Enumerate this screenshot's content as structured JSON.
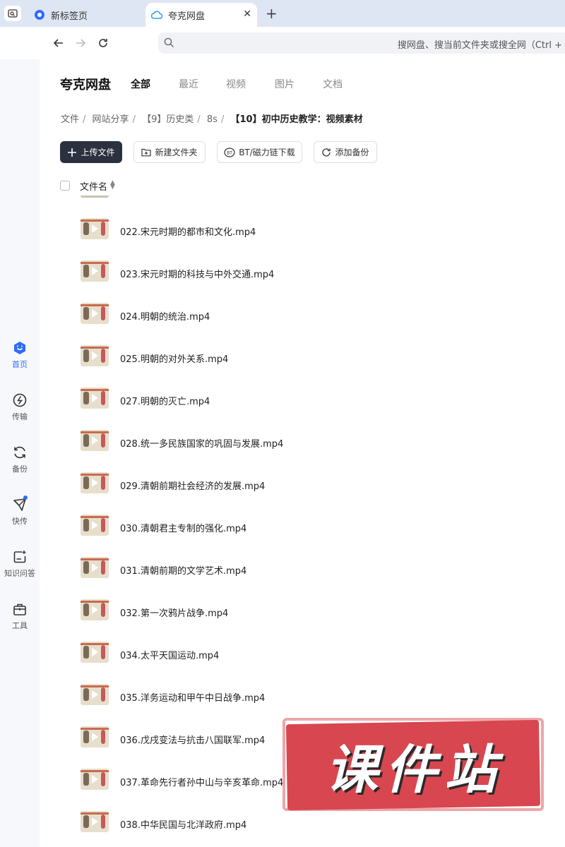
{
  "browser": {
    "tabs": [
      {
        "title": "新标签页",
        "active": false
      },
      {
        "title": "夸克网盘",
        "active": true
      }
    ],
    "address_placeholder": "搜网盘、搜当前文件夹或搜全网（Ctrl +"
  },
  "rail": {
    "items": [
      {
        "label": "首页",
        "icon": "smile-cloud-icon",
        "active": true
      },
      {
        "label": "传输",
        "icon": "transfer-icon"
      },
      {
        "label": "备份",
        "icon": "backup-icon"
      },
      {
        "label": "快传",
        "icon": "paper-plane-icon"
      },
      {
        "label": "知识问答",
        "icon": "qa-icon"
      },
      {
        "label": "工具",
        "icon": "toolbox-icon"
      }
    ]
  },
  "header": {
    "brand": "夸克网盘",
    "categories": [
      "全部",
      "最近",
      "视频",
      "图片",
      "文档"
    ]
  },
  "breadcrumb": [
    "文件",
    "网站分享",
    "【9】历史类",
    "8s",
    "【10】初中历史教学：视频素材"
  ],
  "actions": {
    "upload": "上传文件",
    "new_folder": "新建文件夹",
    "bt": "BT/磁力链下载",
    "backup": "添加备份"
  },
  "table": {
    "column": "文件名"
  },
  "files": [
    "022.宋元时期的都市和文化.mp4",
    "023.宋元时期的科技与中外交通.mp4",
    "024.明朝的统治.mp4",
    "025.明朝的对外关系.mp4",
    "027.明朝的灭亡.mp4",
    "028.统一多民族国家的巩固与发展.mp4",
    "029.清朝前期社会经济的发展.mp4",
    "030.清朝君主专制的强化.mp4",
    "031.清朝前期的文学艺术.mp4",
    "032.第一次鸦片战争.mp4",
    "034.太平天国运动.mp4",
    "035.洋务运动和甲午中日战争.mp4",
    "036.戊戌变法与抗击八国联军.mp4",
    "037.革命先行者孙中山与辛亥革命.mp4",
    "038.中华民国与北洋政府.mp4"
  ],
  "watermark": "课件站",
  "colors": {
    "accent": "#2f6bff",
    "primary_button": "#2c3140",
    "stamp": "#d8464f"
  }
}
